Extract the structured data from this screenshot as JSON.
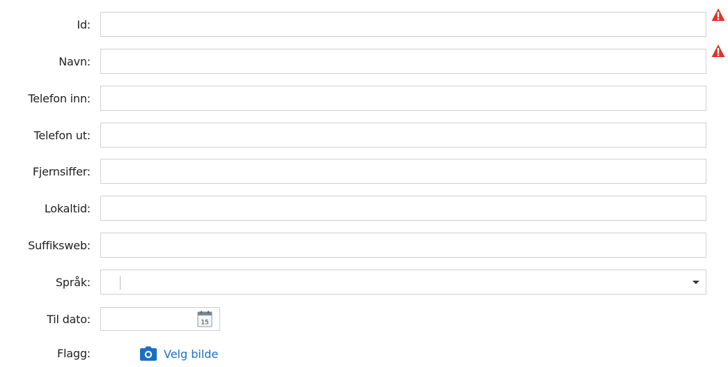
{
  "form": {
    "fields": [
      {
        "label": "Id:",
        "value": "",
        "warning": true
      },
      {
        "label": "Navn:",
        "value": "",
        "warning": true
      },
      {
        "label": "Telefon inn:",
        "value": "",
        "warning": false
      },
      {
        "label": "Telefon ut:",
        "value": "",
        "warning": false
      },
      {
        "label": "Fjernsiffer:",
        "value": "",
        "warning": false
      },
      {
        "label": "Lokaltid:",
        "value": "",
        "warning": false
      },
      {
        "label": "Suffiksweb:",
        "value": "",
        "warning": false
      }
    ],
    "language": {
      "label": "Språk:",
      "selected": ""
    },
    "to_date": {
      "label": "Til dato:",
      "value": "",
      "calendar_day": "15",
      "icon": "calendar-icon"
    },
    "flag": {
      "label": "Flagg:",
      "action_label": "Velg bilde",
      "icon": "camera-icon"
    }
  },
  "colors": {
    "warning": "#e0332b",
    "link": "#1a6fc4",
    "border": "#cfcfcf"
  }
}
